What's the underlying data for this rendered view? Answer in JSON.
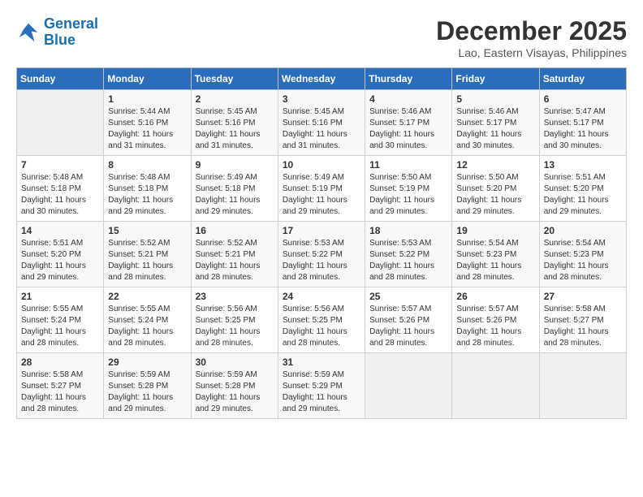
{
  "logo": {
    "line1": "General",
    "line2": "Blue"
  },
  "title": "December 2025",
  "subtitle": "Lao, Eastern Visayas, Philippines",
  "headers": [
    "Sunday",
    "Monday",
    "Tuesday",
    "Wednesday",
    "Thursday",
    "Friday",
    "Saturday"
  ],
  "weeks": [
    [
      {
        "day": "",
        "sunrise": "",
        "sunset": "",
        "daylight": ""
      },
      {
        "day": "1",
        "sunrise": "Sunrise: 5:44 AM",
        "sunset": "Sunset: 5:16 PM",
        "daylight": "Daylight: 11 hours and 31 minutes."
      },
      {
        "day": "2",
        "sunrise": "Sunrise: 5:45 AM",
        "sunset": "Sunset: 5:16 PM",
        "daylight": "Daylight: 11 hours and 31 minutes."
      },
      {
        "day": "3",
        "sunrise": "Sunrise: 5:45 AM",
        "sunset": "Sunset: 5:16 PM",
        "daylight": "Daylight: 11 hours and 31 minutes."
      },
      {
        "day": "4",
        "sunrise": "Sunrise: 5:46 AM",
        "sunset": "Sunset: 5:17 PM",
        "daylight": "Daylight: 11 hours and 30 minutes."
      },
      {
        "day": "5",
        "sunrise": "Sunrise: 5:46 AM",
        "sunset": "Sunset: 5:17 PM",
        "daylight": "Daylight: 11 hours and 30 minutes."
      },
      {
        "day": "6",
        "sunrise": "Sunrise: 5:47 AM",
        "sunset": "Sunset: 5:17 PM",
        "daylight": "Daylight: 11 hours and 30 minutes."
      }
    ],
    [
      {
        "day": "7",
        "sunrise": "Sunrise: 5:48 AM",
        "sunset": "Sunset: 5:18 PM",
        "daylight": "Daylight: 11 hours and 30 minutes."
      },
      {
        "day": "8",
        "sunrise": "Sunrise: 5:48 AM",
        "sunset": "Sunset: 5:18 PM",
        "daylight": "Daylight: 11 hours and 29 minutes."
      },
      {
        "day": "9",
        "sunrise": "Sunrise: 5:49 AM",
        "sunset": "Sunset: 5:18 PM",
        "daylight": "Daylight: 11 hours and 29 minutes."
      },
      {
        "day": "10",
        "sunrise": "Sunrise: 5:49 AM",
        "sunset": "Sunset: 5:19 PM",
        "daylight": "Daylight: 11 hours and 29 minutes."
      },
      {
        "day": "11",
        "sunrise": "Sunrise: 5:50 AM",
        "sunset": "Sunset: 5:19 PM",
        "daylight": "Daylight: 11 hours and 29 minutes."
      },
      {
        "day": "12",
        "sunrise": "Sunrise: 5:50 AM",
        "sunset": "Sunset: 5:20 PM",
        "daylight": "Daylight: 11 hours and 29 minutes."
      },
      {
        "day": "13",
        "sunrise": "Sunrise: 5:51 AM",
        "sunset": "Sunset: 5:20 PM",
        "daylight": "Daylight: 11 hours and 29 minutes."
      }
    ],
    [
      {
        "day": "14",
        "sunrise": "Sunrise: 5:51 AM",
        "sunset": "Sunset: 5:20 PM",
        "daylight": "Daylight: 11 hours and 29 minutes."
      },
      {
        "day": "15",
        "sunrise": "Sunrise: 5:52 AM",
        "sunset": "Sunset: 5:21 PM",
        "daylight": "Daylight: 11 hours and 28 minutes."
      },
      {
        "day": "16",
        "sunrise": "Sunrise: 5:52 AM",
        "sunset": "Sunset: 5:21 PM",
        "daylight": "Daylight: 11 hours and 28 minutes."
      },
      {
        "day": "17",
        "sunrise": "Sunrise: 5:53 AM",
        "sunset": "Sunset: 5:22 PM",
        "daylight": "Daylight: 11 hours and 28 minutes."
      },
      {
        "day": "18",
        "sunrise": "Sunrise: 5:53 AM",
        "sunset": "Sunset: 5:22 PM",
        "daylight": "Daylight: 11 hours and 28 minutes."
      },
      {
        "day": "19",
        "sunrise": "Sunrise: 5:54 AM",
        "sunset": "Sunset: 5:23 PM",
        "daylight": "Daylight: 11 hours and 28 minutes."
      },
      {
        "day": "20",
        "sunrise": "Sunrise: 5:54 AM",
        "sunset": "Sunset: 5:23 PM",
        "daylight": "Daylight: 11 hours and 28 minutes."
      }
    ],
    [
      {
        "day": "21",
        "sunrise": "Sunrise: 5:55 AM",
        "sunset": "Sunset: 5:24 PM",
        "daylight": "Daylight: 11 hours and 28 minutes."
      },
      {
        "day": "22",
        "sunrise": "Sunrise: 5:55 AM",
        "sunset": "Sunset: 5:24 PM",
        "daylight": "Daylight: 11 hours and 28 minutes."
      },
      {
        "day": "23",
        "sunrise": "Sunrise: 5:56 AM",
        "sunset": "Sunset: 5:25 PM",
        "daylight": "Daylight: 11 hours and 28 minutes."
      },
      {
        "day": "24",
        "sunrise": "Sunrise: 5:56 AM",
        "sunset": "Sunset: 5:25 PM",
        "daylight": "Daylight: 11 hours and 28 minutes."
      },
      {
        "day": "25",
        "sunrise": "Sunrise: 5:57 AM",
        "sunset": "Sunset: 5:26 PM",
        "daylight": "Daylight: 11 hours and 28 minutes."
      },
      {
        "day": "26",
        "sunrise": "Sunrise: 5:57 AM",
        "sunset": "Sunset: 5:26 PM",
        "daylight": "Daylight: 11 hours and 28 minutes."
      },
      {
        "day": "27",
        "sunrise": "Sunrise: 5:58 AM",
        "sunset": "Sunset: 5:27 PM",
        "daylight": "Daylight: 11 hours and 28 minutes."
      }
    ],
    [
      {
        "day": "28",
        "sunrise": "Sunrise: 5:58 AM",
        "sunset": "Sunset: 5:27 PM",
        "daylight": "Daylight: 11 hours and 28 minutes."
      },
      {
        "day": "29",
        "sunrise": "Sunrise: 5:59 AM",
        "sunset": "Sunset: 5:28 PM",
        "daylight": "Daylight: 11 hours and 29 minutes."
      },
      {
        "day": "30",
        "sunrise": "Sunrise: 5:59 AM",
        "sunset": "Sunset: 5:28 PM",
        "daylight": "Daylight: 11 hours and 29 minutes."
      },
      {
        "day": "31",
        "sunrise": "Sunrise: 5:59 AM",
        "sunset": "Sunset: 5:29 PM",
        "daylight": "Daylight: 11 hours and 29 minutes."
      },
      {
        "day": "",
        "sunrise": "",
        "sunset": "",
        "daylight": ""
      },
      {
        "day": "",
        "sunrise": "",
        "sunset": "",
        "daylight": ""
      },
      {
        "day": "",
        "sunrise": "",
        "sunset": "",
        "daylight": ""
      }
    ]
  ]
}
